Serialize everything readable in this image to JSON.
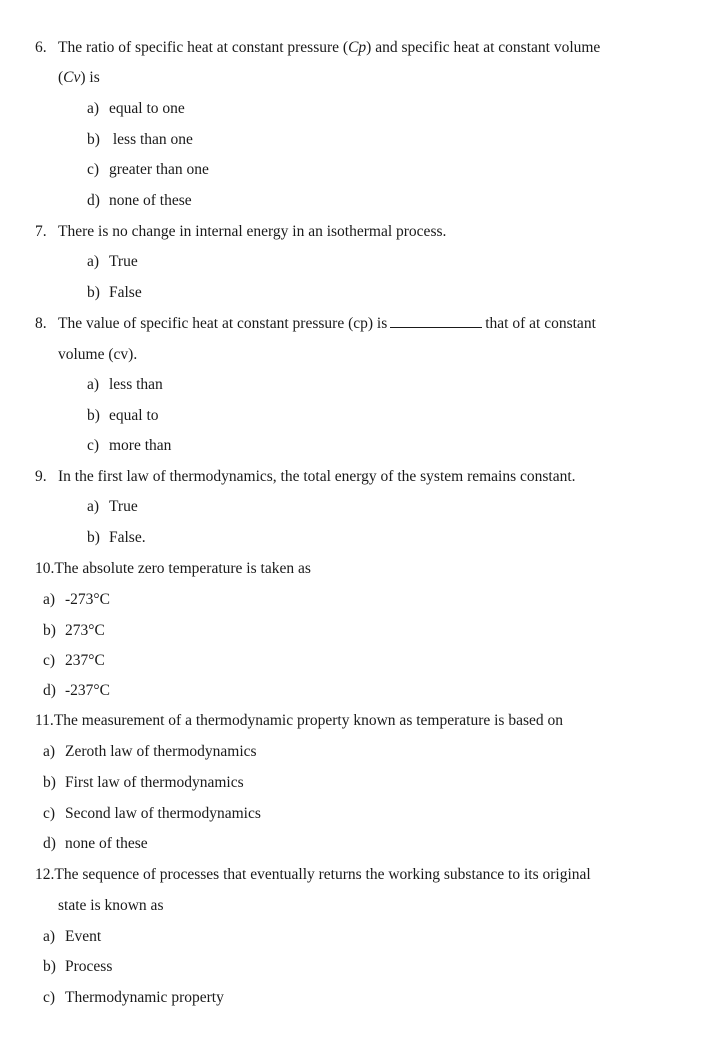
{
  "questions": [
    {
      "number": "6.",
      "text_line1": "The ratio of specific heat at constant pressure (",
      "text_line1_italic": "Cp",
      "text_line1_end": ") and specific heat at constant volume",
      "text_line2_open": "(",
      "text_line2_italic": "Cv",
      "text_line2_end": ") is",
      "options": [
        {
          "letter": "a)",
          "text": "equal to one"
        },
        {
          "letter": "b)",
          "text": " less than one"
        },
        {
          "letter": "c)",
          "text": "greater than one"
        },
        {
          "letter": "d)",
          "text": "none of these"
        }
      ]
    },
    {
      "number": "7.",
      "text_line1": "There is no change in internal energy in an isothermal process.",
      "options": [
        {
          "letter": "a)",
          "text": "True"
        },
        {
          "letter": "b)",
          "text": "False"
        }
      ]
    },
    {
      "number": "8.",
      "text_line1_start": "The value of specific heat at constant pressure (cp) is",
      "text_line1_end": "that of at constant",
      "text_line2": "volume (cv).",
      "options": [
        {
          "letter": "a)",
          "text": "less than"
        },
        {
          "letter": "b)",
          "text": "equal to"
        },
        {
          "letter": "c)",
          "text": "more than"
        }
      ]
    },
    {
      "number": "9.",
      "text_line1": "In the first law of thermodynamics, the total energy of the system remains constant.",
      "options": [
        {
          "letter": "a)",
          "text": "True"
        },
        {
          "letter": "b)",
          "text": "False."
        }
      ]
    },
    {
      "number": "10.",
      "text_line1": "The absolute zero temperature is taken as",
      "options": [
        {
          "letter": "a)",
          "text": "-273°C"
        },
        {
          "letter": "b)",
          "text": "273°C"
        },
        {
          "letter": "c)",
          "text": "237°C"
        },
        {
          "letter": "d)",
          "text": "-237°C"
        }
      ]
    },
    {
      "number": "11.",
      "text_line1": "The measurement of a thermodynamic property known as temperature is based on",
      "options": [
        {
          "letter": "a)",
          "text": "Zeroth law of thermodynamics"
        },
        {
          "letter": "b)",
          "text": "First law of thermodynamics"
        },
        {
          "letter": "c)",
          "text": "Second law of thermodynamics"
        },
        {
          "letter": "d)",
          "text": "none of these"
        }
      ]
    },
    {
      "number": "12.",
      "text_line1": "The sequence of processes that eventually returns the working substance to its original",
      "text_line2": "state is known as",
      "options": [
        {
          "letter": "a)",
          "text": "Event"
        },
        {
          "letter": "b)",
          "text": "Process"
        },
        {
          "letter": "c)",
          "text": "Thermodynamic property"
        }
      ]
    }
  ]
}
